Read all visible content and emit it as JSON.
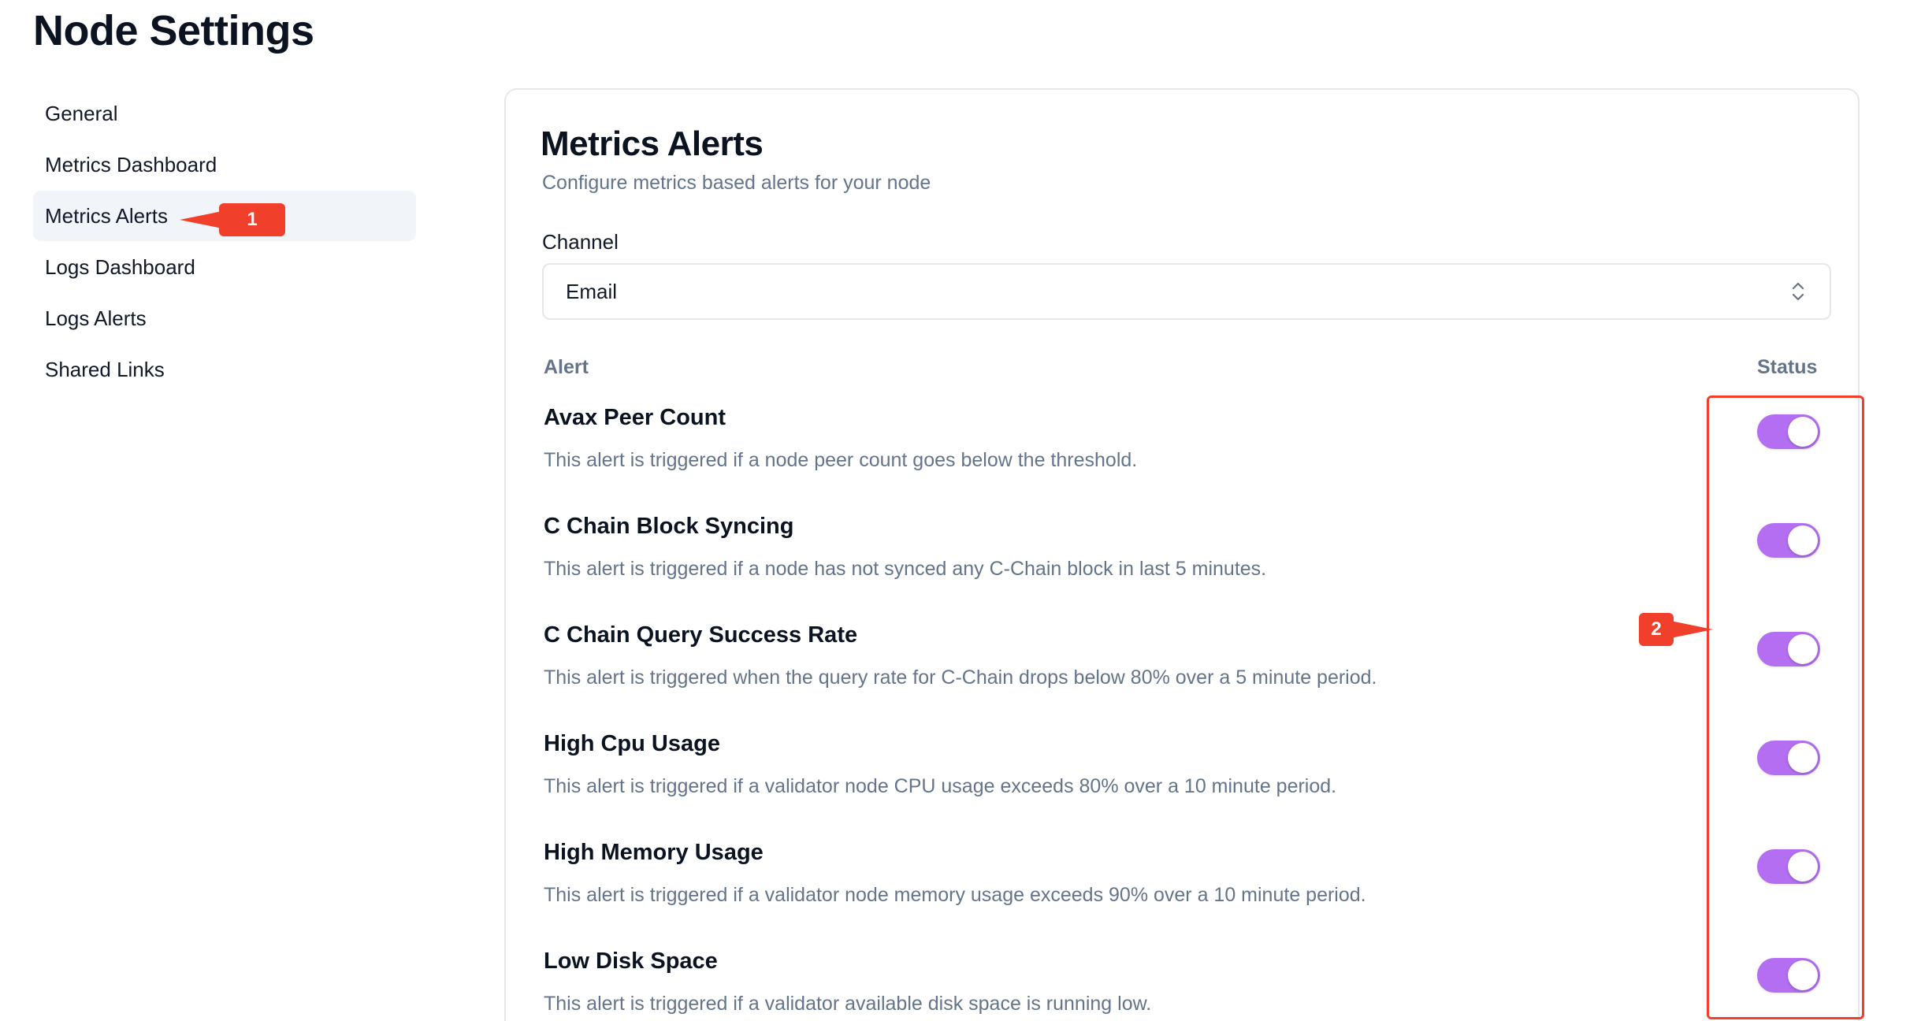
{
  "page": {
    "title": "Node Settings"
  },
  "sidebar": {
    "items": [
      {
        "label": "General",
        "active": false
      },
      {
        "label": "Metrics Dashboard",
        "active": false
      },
      {
        "label": "Metrics Alerts",
        "active": true
      },
      {
        "label": "Logs Dashboard",
        "active": false
      },
      {
        "label": "Logs Alerts",
        "active": false
      },
      {
        "label": "Shared Links",
        "active": false
      }
    ]
  },
  "panel": {
    "title": "Metrics Alerts",
    "subtitle": "Configure metrics based alerts for your node",
    "channel": {
      "label": "Channel",
      "selected": "Email",
      "icon": "chevron-up-down-icon"
    },
    "columns": {
      "alert": "Alert",
      "status": "Status"
    },
    "alerts": [
      {
        "name": "Avax Peer Count",
        "description": "This alert is triggered if a node peer count goes below the threshold.",
        "enabled": true
      },
      {
        "name": "C Chain Block Syncing",
        "description": "This alert is triggered if a node has not synced any C-Chain block in last 5 minutes.",
        "enabled": true
      },
      {
        "name": "C Chain Query Success Rate",
        "description": "This alert is triggered when the query rate for C-Chain drops below 80% over a 5 minute period.",
        "enabled": true
      },
      {
        "name": "High Cpu Usage",
        "description": "This alert is triggered if a validator node CPU usage exceeds 80% over a 10 minute period.",
        "enabled": true
      },
      {
        "name": "High Memory Usage",
        "description": "This alert is triggered if a validator node memory usage exceeds 90% over a 10 minute period.",
        "enabled": true
      },
      {
        "name": "Low Disk Space",
        "description": "This alert is triggered if a validator available disk space is running low.",
        "enabled": true
      }
    ]
  },
  "annotations": {
    "callout_1": "1",
    "callout_2": "2",
    "color": "#f0402c"
  },
  "colors": {
    "toggle_on": "#b36ef2",
    "active_nav_bg": "#f1f5f9",
    "muted_text": "#64748b"
  }
}
